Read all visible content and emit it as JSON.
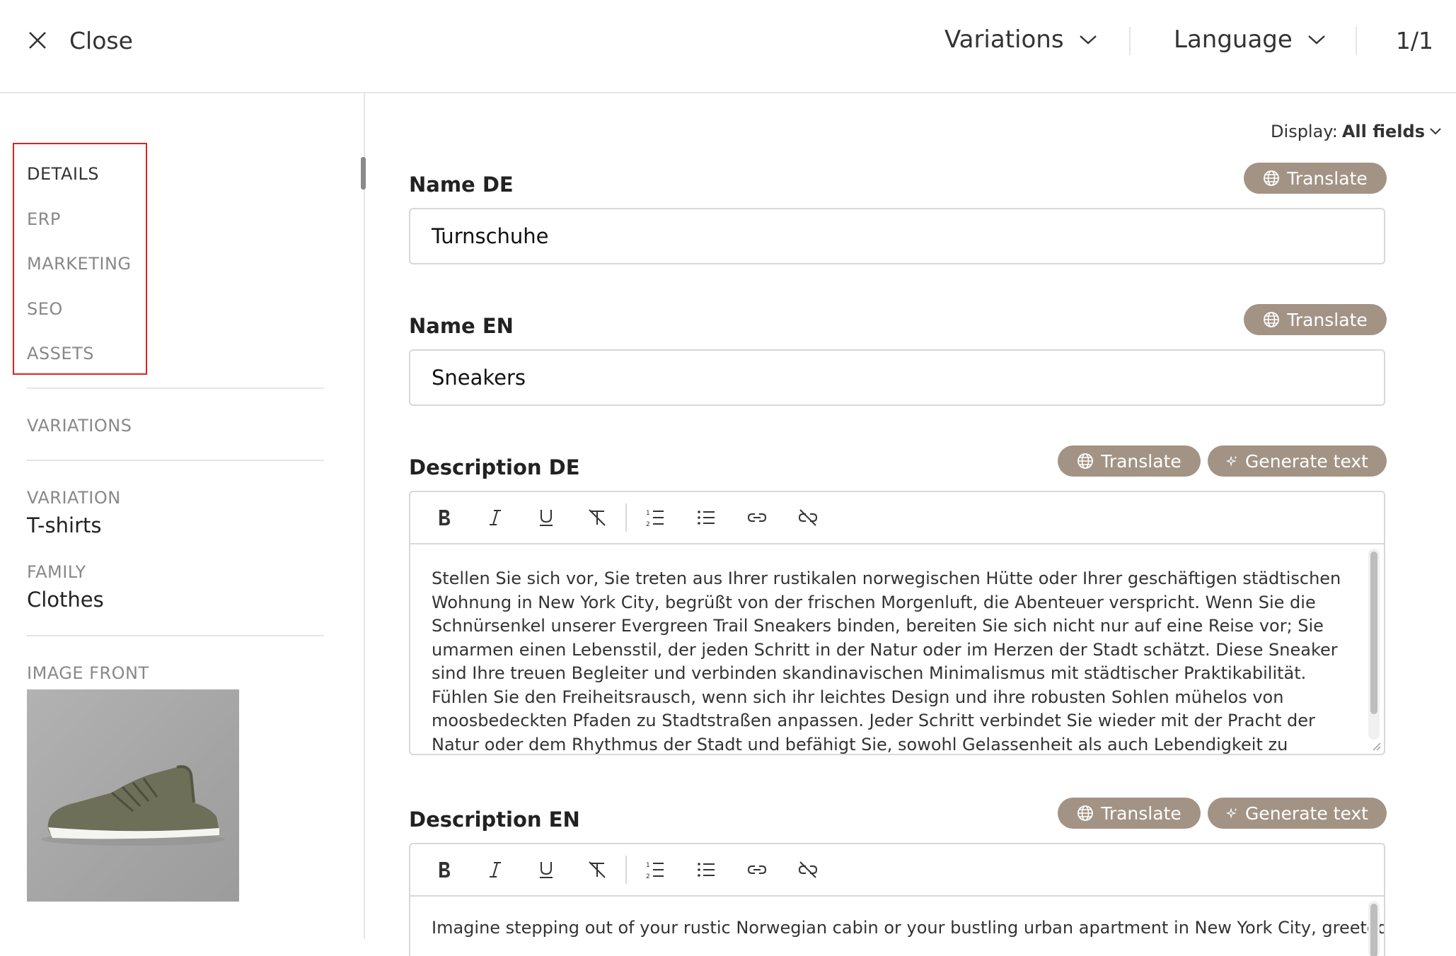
{
  "header": {
    "close_label": "Close",
    "variations_label": "Variations",
    "language_label": "Language",
    "counter": "1/1"
  },
  "sidebar": {
    "nav": [
      {
        "label": "DETAILS",
        "active": true
      },
      {
        "label": "ERP"
      },
      {
        "label": "MARKETING"
      },
      {
        "label": "SEO"
      },
      {
        "label": "ASSETS"
      }
    ],
    "variations_link": "VARIATIONS",
    "variation": {
      "label": "VARIATION",
      "value": "T-shirts"
    },
    "family": {
      "label": "FAMILY",
      "value": "Clothes"
    },
    "image_front_label": "IMAGE FRONT"
  },
  "main": {
    "display_prefix": "Display:",
    "display_value": "All fields",
    "translate_label": "Translate",
    "generate_label": "Generate text",
    "fields": {
      "name_de": {
        "label": "Name DE",
        "value": "Turnschuhe"
      },
      "name_en": {
        "label": "Name EN",
        "value": "Sneakers"
      },
      "description_de": {
        "label": "Description DE",
        "value": "Stellen Sie sich vor, Sie treten aus Ihrer rustikalen norwegischen Hütte oder Ihrer geschäftigen städtischen Wohnung in New York City, begrüßt von der frischen Morgenluft, die Abenteuer verspricht. Wenn Sie die Schnürsenkel unserer Evergreen Trail Sneakers binden, bereiten Sie sich nicht nur auf eine Reise vor; Sie umarmen einen Lebensstil, der jeden Schritt in der Natur oder im Herzen der Stadt schätzt. Diese Sneaker sind Ihre treuen Begleiter und verbinden skandinavischen Minimalismus mit städtischer Praktikabilität. Fühlen Sie den Freiheitsrausch, wenn sich ihr leichtes Design und ihre robusten Sohlen mühelos von moosbedeckten Pfaden zu Stadtstraßen anpassen. Jeder Schritt verbindet Sie wieder mit der Pracht der Natur oder dem Rhythmus der Stadt und befähigt Sie, sowohl Gelassenheit als auch Lebendigkeit zu umarmen. Treten Sie in die Welt ein, in der Ihre"
      },
      "description_en": {
        "label": "Description EN",
        "value": "Imagine stepping out of your rustic Norwegian cabin or your bustling urban apartment in New York City, greeted"
      }
    }
  },
  "colors": {
    "accent": "#a39385",
    "highlight_box": "#e02020"
  },
  "icons": {
    "toolbar": [
      "bold-icon",
      "italic-icon",
      "underline-icon",
      "clear-format-icon",
      "ordered-list-icon",
      "bullet-list-icon",
      "link-icon",
      "unlink-icon"
    ]
  }
}
